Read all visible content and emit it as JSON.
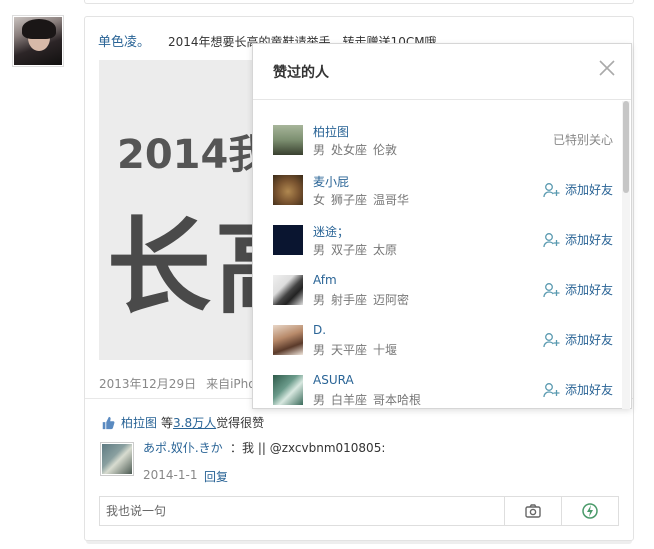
{
  "post": {
    "author": "单色凌。",
    "text": "2014年想要长高的童鞋请举手，转走赠送10CM哦",
    "image_text_line1": "2014我",
    "image_text_line2": "长高",
    "date": "2013年12月29日",
    "source": "来自iPhone"
  },
  "likes": {
    "first_user": "柏拉图",
    "prefix": "等",
    "count": "3.8万人",
    "suffix": "觉得很赞"
  },
  "comment": {
    "user": "あポ.奴仆.きか",
    "text": "：我 || @zxcvbnm010805:",
    "date": "2014-1-1",
    "reply_label": "回复"
  },
  "comment_input": {
    "placeholder": "我也说一句"
  },
  "popup": {
    "title": "赞过的人",
    "users": [
      {
        "name": "柏拉图",
        "gender": "男",
        "sign": "处女座",
        "city": "伦敦",
        "action": "已特别关心",
        "action_type": "status"
      },
      {
        "name": "麦小屁",
        "gender": "女",
        "sign": "狮子座",
        "city": "温哥华",
        "action": "添加好友",
        "action_type": "add"
      },
      {
        "name": "迷途；",
        "gender": "男",
        "sign": "双子座",
        "city": "太原",
        "action": "添加好友",
        "action_type": "add"
      },
      {
        "name": "Afm",
        "gender": "男",
        "sign": "射手座",
        "city": "迈阿密",
        "action": "添加好友",
        "action_type": "add"
      },
      {
        "name": "D.",
        "gender": "男",
        "sign": "天平座",
        "city": "十堰",
        "action": "添加好友",
        "action_type": "add"
      },
      {
        "name": "ASURA",
        "gender": "男",
        "sign": "白羊座",
        "city": "哥本哈根",
        "action": "添加好友",
        "action_type": "add"
      }
    ]
  },
  "colors": {
    "link": "#2a6496",
    "muted": "#888888",
    "border": "#e3e3e3"
  }
}
